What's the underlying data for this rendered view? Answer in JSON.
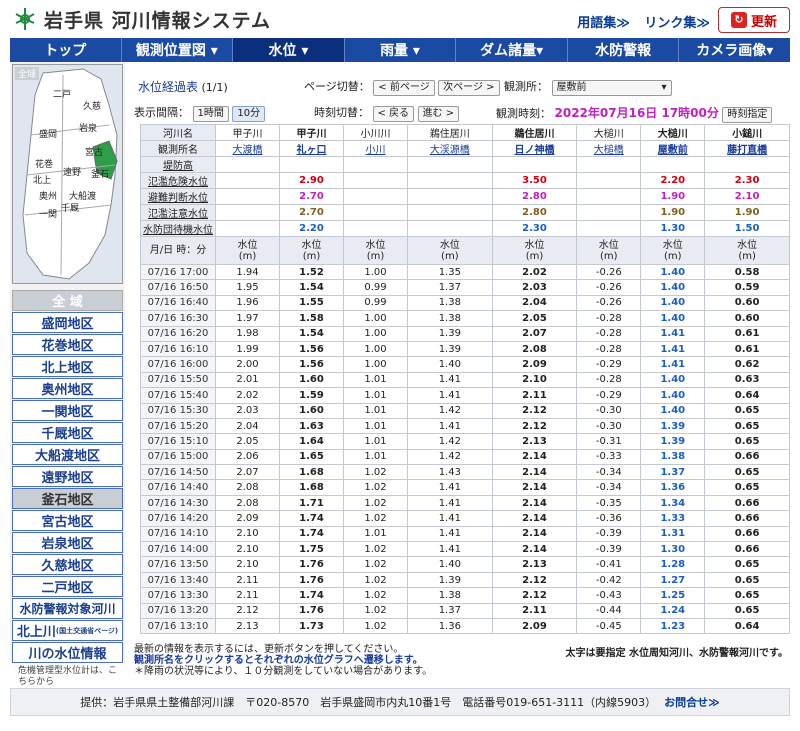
{
  "header": {
    "title": "岩手県 河川情報システム",
    "links": [
      "用語集≫",
      "リンク集≫"
    ],
    "reload": "更新"
  },
  "nav": [
    "トップ",
    "観測位置図 ▾",
    "水位 ▾",
    "雨量 ▾",
    "ダム諸量▾",
    "水防警報",
    "カメラ画像▾"
  ],
  "sidebar": {
    "map_label": "全域",
    "map_towns": [
      "二戸",
      "久慈",
      "岩泉",
      "盛岡",
      "宮古",
      "花巻",
      "遠野",
      "釜石",
      "北上",
      "奥州",
      "大船渡",
      "一関",
      "千厩"
    ],
    "zones": [
      "全 域",
      "盛岡地区",
      "花巻地区",
      "北上地区",
      "奥州地区",
      "一関地区",
      "千厩地区",
      "大船渡地区",
      "遠野地区",
      "釜石地区",
      "宮古地区",
      "岩泉地区",
      "久慈地区",
      "二戸地区",
      "水防警報対象河川",
      "北上川",
      "川の水位情報"
    ],
    "kitakami_sub": "(国土交通省ページ)",
    "note": "危機管理型水位計は、こちらから"
  },
  "controls": {
    "title": "水位経過表",
    "pages": "(1/1)",
    "page_switch": "ページ切替：",
    "prev_page": "< 前ページ",
    "next_page": "次ページ >",
    "station_label": "観測所：",
    "station_value": "屋敷前",
    "interval_label": "表示間隔：",
    "interval_1h": "1時間",
    "interval_10m": "10分",
    "time_switch": "時刻切替：",
    "back": "< 戻る",
    "forward": "進む >",
    "obs_time_label": "観測時刻：",
    "obs_time": "2022年07月16日 17時00分",
    "time_spec": "時刻指定"
  },
  "table": {
    "row_labels": [
      "河川名",
      "観測所名",
      "堤防高",
      "氾濫危険水位",
      "避難判断水位",
      "氾濫注意水位",
      "水防団待機水位",
      "月/日 時：分"
    ],
    "rivers": [
      "甲子川",
      "甲子川",
      "小川川",
      "鵜住居川",
      "鵜住居川",
      "大槌川",
      "大槌川",
      "小鎚川"
    ],
    "stations": [
      "大渡橋",
      "礼ヶ口",
      "小川",
      "大渓源橋",
      "日ノ神橋",
      "大槌橋",
      "屋敷前",
      "藤打直橋"
    ],
    "danger": [
      "",
      "2.90",
      "",
      "",
      "3.50",
      "",
      "2.20",
      "2.30"
    ],
    "evac": [
      "",
      "2.70",
      "",
      "",
      "2.80",
      "",
      "1.90",
      "2.10"
    ],
    "caution": [
      "",
      "2.70",
      "",
      "",
      "2.80",
      "",
      "1.90",
      "1.90"
    ],
    "standby": [
      "",
      "2.20",
      "",
      "",
      "2.30",
      "",
      "1.30",
      "1.50"
    ],
    "col_header": "水位\n(m)",
    "rows": [
      [
        "07/16 17:00",
        "1.94",
        "1.52",
        "1.00",
        "1.35",
        "2.02",
        "-0.26",
        "1.40",
        "0.58"
      ],
      [
        "07/16 16:50",
        "1.95",
        "1.54",
        "0.99",
        "1.37",
        "2.03",
        "-0.26",
        "1.40",
        "0.59"
      ],
      [
        "07/16 16:40",
        "1.96",
        "1.55",
        "0.99",
        "1.38",
        "2.04",
        "-0.26",
        "1.40",
        "0.60"
      ],
      [
        "07/16 16:30",
        "1.97",
        "1.58",
        "1.00",
        "1.38",
        "2.05",
        "-0.28",
        "1.40",
        "0.60"
      ],
      [
        "07/16 16:20",
        "1.98",
        "1.54",
        "1.00",
        "1.39",
        "2.07",
        "-0.28",
        "1.41",
        "0.61"
      ],
      [
        "07/16 16:10",
        "1.99",
        "1.56",
        "1.00",
        "1.39",
        "2.08",
        "-0.28",
        "1.41",
        "0.61"
      ],
      [
        "07/16 16:00",
        "2.00",
        "1.56",
        "1.00",
        "1.40",
        "2.09",
        "-0.29",
        "1.41",
        "0.62"
      ],
      [
        "07/16 15:50",
        "2.01",
        "1.60",
        "1.01",
        "1.41",
        "2.10",
        "-0.28",
        "1.40",
        "0.63"
      ],
      [
        "07/16 15:40",
        "2.02",
        "1.59",
        "1.01",
        "1.41",
        "2.11",
        "-0.29",
        "1.40",
        "0.64"
      ],
      [
        "07/16 15:30",
        "2.03",
        "1.60",
        "1.01",
        "1.42",
        "2.12",
        "-0.30",
        "1.40",
        "0.65"
      ],
      [
        "07/16 15:20",
        "2.04",
        "1.63",
        "1.01",
        "1.41",
        "2.12",
        "-0.30",
        "1.39",
        "0.65"
      ],
      [
        "07/16 15:10",
        "2.05",
        "1.64",
        "1.01",
        "1.42",
        "2.13",
        "-0.31",
        "1.39",
        "0.65"
      ],
      [
        "07/16 15:00",
        "2.06",
        "1.65",
        "1.01",
        "1.42",
        "2.14",
        "-0.33",
        "1.38",
        "0.66"
      ],
      [
        "07/16 14:50",
        "2.07",
        "1.68",
        "1.02",
        "1.43",
        "2.14",
        "-0.34",
        "1.37",
        "0.65"
      ],
      [
        "07/16 14:40",
        "2.08",
        "1.68",
        "1.02",
        "1.41",
        "2.14",
        "-0.34",
        "1.36",
        "0.65"
      ],
      [
        "07/16 14:30",
        "2.08",
        "1.71",
        "1.02",
        "1.41",
        "2.14",
        "-0.35",
        "1.34",
        "0.66"
      ],
      [
        "07/16 14:20",
        "2.09",
        "1.74",
        "1.02",
        "1.41",
        "2.14",
        "-0.36",
        "1.33",
        "0.66"
      ],
      [
        "07/16 14:10",
        "2.10",
        "1.74",
        "1.01",
        "1.41",
        "2.14",
        "-0.39",
        "1.31",
        "0.66"
      ],
      [
        "07/16 14:00",
        "2.10",
        "1.75",
        "1.02",
        "1.41",
        "2.14",
        "-0.39",
        "1.30",
        "0.66"
      ],
      [
        "07/16 13:50",
        "2.10",
        "1.76",
        "1.02",
        "1.40",
        "2.13",
        "-0.41",
        "1.28",
        "0.65"
      ],
      [
        "07/16 13:40",
        "2.11",
        "1.76",
        "1.02",
        "1.39",
        "2.12",
        "-0.42",
        "1.27",
        "0.65"
      ],
      [
        "07/16 13:30",
        "2.11",
        "1.74",
        "1.02",
        "1.38",
        "2.12",
        "-0.43",
        "1.25",
        "0.65"
      ],
      [
        "07/16 13:20",
        "2.12",
        "1.76",
        "1.02",
        "1.37",
        "2.11",
        "-0.44",
        "1.24",
        "0.65"
      ],
      [
        "07/16 13:10",
        "2.13",
        "1.73",
        "1.02",
        "1.36",
        "2.09",
        "-0.45",
        "1.23",
        "0.64"
      ]
    ]
  },
  "notes": [
    "最新の情報を表示するには、更新ボタンを押してください。",
    "観測所名をクリックするとそれぞれの水位グラフへ遷移します。",
    "＊降雨の状況等により、１０分観測をしていない場合があります。"
  ],
  "notes_right": "太字は要指定 水位周知河川、水防警報河川です。",
  "footer": {
    "text": "提供：岩手県県土整備部河川課　〒020-8570　岩手県盛岡市内丸10番1号　電話番号019-651-3111（内線5903）",
    "contact": "お問合せ≫"
  }
}
